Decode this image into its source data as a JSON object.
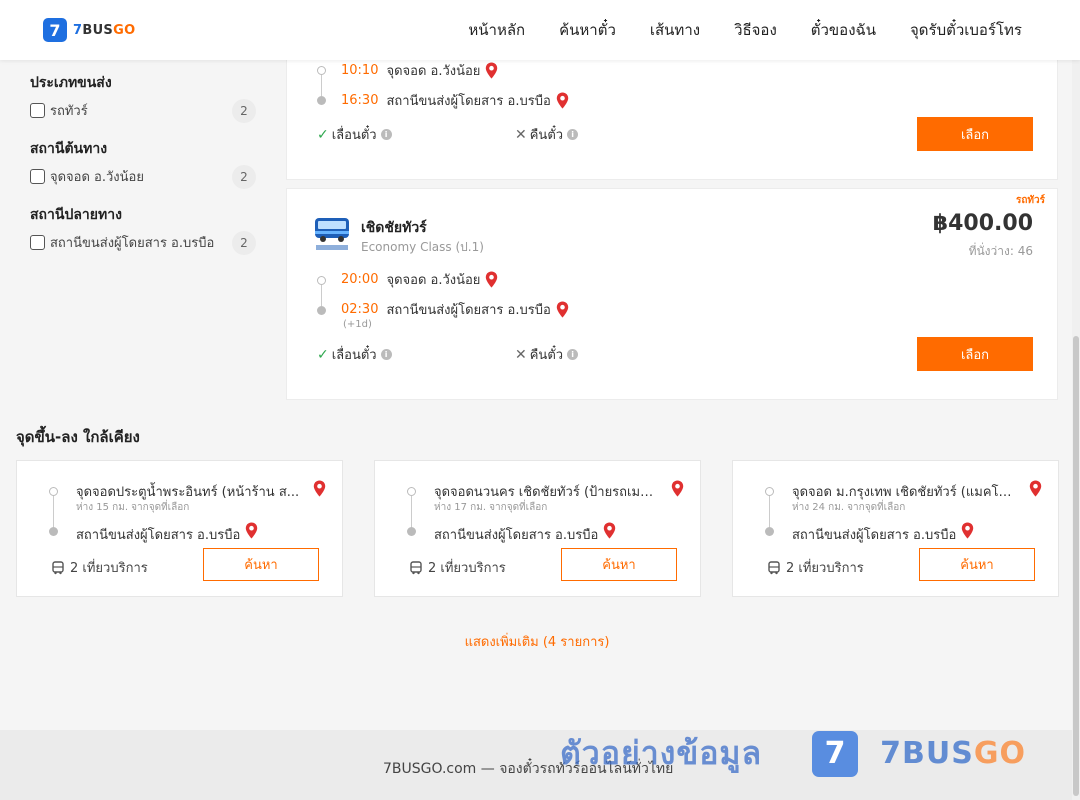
{
  "header": {
    "logo_number": "7",
    "logo_seven": "7",
    "logo_bus": "BUS",
    "logo_go": "GO",
    "nav": [
      "หน้าหลัก",
      "ค้นหาตั๋ว",
      "เส้นทาง",
      "วิธีจอง",
      "ตั๋วของฉัน",
      "จุดรับตั๋วเบอร์โทร"
    ]
  },
  "filters": [
    {
      "title": "ประเภทขนส่ง",
      "option": "รถทัวร์",
      "count": "2"
    },
    {
      "title": "สถานีต้นทาง",
      "option": "จุดจอด อ.วังน้อย",
      "count": "2"
    },
    {
      "title": "สถานีปลายทาง",
      "option": "สถานีขนส่งผู้โดยสาร อ.บรบือ",
      "count": "2"
    }
  ],
  "trip1": {
    "depart_time": "10:10",
    "depart_stop": "จุดจอด อ.วังน้อย",
    "arrive_time": "16:30",
    "arrive_stop": "สถานีขนส่งผู้โดยสาร อ.บรบือ",
    "change_label": "เลื่อนตั๋ว",
    "refund_label": "คืนตั๋ว",
    "select_label": "เลือก"
  },
  "trip2": {
    "type_tag": "รถทัวร์",
    "operator": "เชิดชัยทัวร์",
    "class": "Economy Class (ป.1)",
    "price": "฿400.00",
    "seats": "ที่นั่งว่าง: 46",
    "depart_time": "20:00",
    "depart_stop": "จุดจอด อ.วังน้อย",
    "arrive_time": "02:30",
    "arrive_stop": "สถานีขนส่งผู้โดยสาร อ.บรบือ",
    "next_day": "(+1d)",
    "change_label": "เลื่อนตั๋ว",
    "refund_label": "คืนตั๋ว",
    "select_label": "เลือก"
  },
  "nearby": {
    "title": "จุดขึ้น-ลง ใกล้เคียง",
    "cards": [
      {
        "origin": "จุดจอดประตูน้ำพระอินทร์ (หน้าร้าน ส...",
        "distance": "ห่าง 15 กม. จากจุดที่เลือก",
        "dest": "สถานีขนส่งผู้โดยสาร อ.บรบือ",
        "trips": "2 เที่ยวบริการ",
        "search_label": "ค้นหา"
      },
      {
        "origin": "จุดจอดนวนคร เชิดชัยทัวร์ (ป้ายรถเมล์...",
        "distance": "ห่าง 17 กม. จากจุดที่เลือก",
        "dest": "สถานีขนส่งผู้โดยสาร อ.บรบือ",
        "trips": "2 เที่ยวบริการ",
        "search_label": "ค้นหา"
      },
      {
        "origin": "จุดจอด ม.กรุงเทพ เชิดชัยทัวร์ (แมคโด...",
        "distance": "ห่าง 24 กม. จากจุดที่เลือก",
        "dest": "สถานีขนส่งผู้โดยสาร อ.บรบือ",
        "trips": "2 เที่ยวบริการ",
        "search_label": "ค้นหา"
      }
    ],
    "show_more": "แสดงเพิ่มเติม (4 รายการ)"
  },
  "footer": {
    "text": "7BUSGO.com — จองตั๋วรถทัวร์ออนไลน์ทั่วไทย"
  },
  "watermark": {
    "text": "ตัวอย่างข้อมูล",
    "badge": "7",
    "brand_bus": "7BUS",
    "brand_go": "GO"
  },
  "colors": {
    "accent": "#ff6b00",
    "brand_blue": "#1e6fe0",
    "check_green": "#2fa84f",
    "pin_red": "#e03030"
  }
}
